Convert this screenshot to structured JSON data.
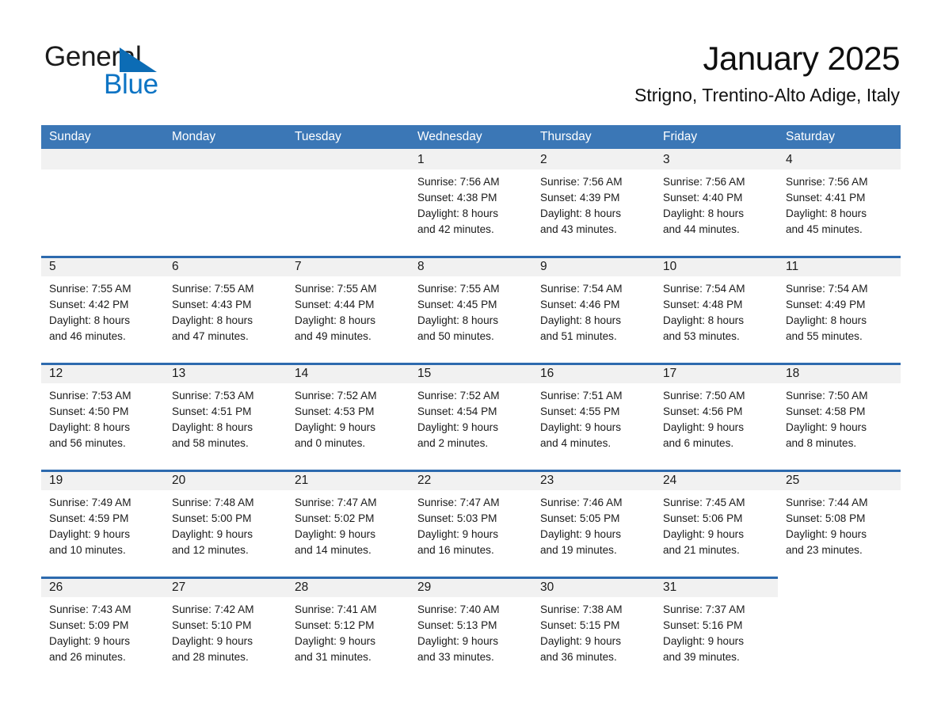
{
  "brand": {
    "line1": "General",
    "line2": "Blue",
    "triangle_color": "#0c6cb5",
    "text_color": "#0d74c4"
  },
  "header": {
    "month_title": "January 2025",
    "location": "Strigno, Trentino-Alto Adige, Italy"
  },
  "colors": {
    "header_blue": "#3b77b6",
    "row_divider_blue": "#2d6aae",
    "daynum_band": "#f1f1f1",
    "page_background": "#ffffff"
  },
  "weekdays": [
    "Sunday",
    "Monday",
    "Tuesday",
    "Wednesday",
    "Thursday",
    "Friday",
    "Saturday"
  ],
  "weeks": [
    [
      {
        "day": "",
        "sunrise": "",
        "sunset": "",
        "daylight1": "",
        "daylight2": ""
      },
      {
        "day": "",
        "sunrise": "",
        "sunset": "",
        "daylight1": "",
        "daylight2": ""
      },
      {
        "day": "",
        "sunrise": "",
        "sunset": "",
        "daylight1": "",
        "daylight2": ""
      },
      {
        "day": "1",
        "sunrise": "Sunrise: 7:56 AM",
        "sunset": "Sunset: 4:38 PM",
        "daylight1": "Daylight: 8 hours",
        "daylight2": "and 42 minutes."
      },
      {
        "day": "2",
        "sunrise": "Sunrise: 7:56 AM",
        "sunset": "Sunset: 4:39 PM",
        "daylight1": "Daylight: 8 hours",
        "daylight2": "and 43 minutes."
      },
      {
        "day": "3",
        "sunrise": "Sunrise: 7:56 AM",
        "sunset": "Sunset: 4:40 PM",
        "daylight1": "Daylight: 8 hours",
        "daylight2": "and 44 minutes."
      },
      {
        "day": "4",
        "sunrise": "Sunrise: 7:56 AM",
        "sunset": "Sunset: 4:41 PM",
        "daylight1": "Daylight: 8 hours",
        "daylight2": "and 45 minutes."
      }
    ],
    [
      {
        "day": "5",
        "sunrise": "Sunrise: 7:55 AM",
        "sunset": "Sunset: 4:42 PM",
        "daylight1": "Daylight: 8 hours",
        "daylight2": "and 46 minutes."
      },
      {
        "day": "6",
        "sunrise": "Sunrise: 7:55 AM",
        "sunset": "Sunset: 4:43 PM",
        "daylight1": "Daylight: 8 hours",
        "daylight2": "and 47 minutes."
      },
      {
        "day": "7",
        "sunrise": "Sunrise: 7:55 AM",
        "sunset": "Sunset: 4:44 PM",
        "daylight1": "Daylight: 8 hours",
        "daylight2": "and 49 minutes."
      },
      {
        "day": "8",
        "sunrise": "Sunrise: 7:55 AM",
        "sunset": "Sunset: 4:45 PM",
        "daylight1": "Daylight: 8 hours",
        "daylight2": "and 50 minutes."
      },
      {
        "day": "9",
        "sunrise": "Sunrise: 7:54 AM",
        "sunset": "Sunset: 4:46 PM",
        "daylight1": "Daylight: 8 hours",
        "daylight2": "and 51 minutes."
      },
      {
        "day": "10",
        "sunrise": "Sunrise: 7:54 AM",
        "sunset": "Sunset: 4:48 PM",
        "daylight1": "Daylight: 8 hours",
        "daylight2": "and 53 minutes."
      },
      {
        "day": "11",
        "sunrise": "Sunrise: 7:54 AM",
        "sunset": "Sunset: 4:49 PM",
        "daylight1": "Daylight: 8 hours",
        "daylight2": "and 55 minutes."
      }
    ],
    [
      {
        "day": "12",
        "sunrise": "Sunrise: 7:53 AM",
        "sunset": "Sunset: 4:50 PM",
        "daylight1": "Daylight: 8 hours",
        "daylight2": "and 56 minutes."
      },
      {
        "day": "13",
        "sunrise": "Sunrise: 7:53 AM",
        "sunset": "Sunset: 4:51 PM",
        "daylight1": "Daylight: 8 hours",
        "daylight2": "and 58 minutes."
      },
      {
        "day": "14",
        "sunrise": "Sunrise: 7:52 AM",
        "sunset": "Sunset: 4:53 PM",
        "daylight1": "Daylight: 9 hours",
        "daylight2": "and 0 minutes."
      },
      {
        "day": "15",
        "sunrise": "Sunrise: 7:52 AM",
        "sunset": "Sunset: 4:54 PM",
        "daylight1": "Daylight: 9 hours",
        "daylight2": "and 2 minutes."
      },
      {
        "day": "16",
        "sunrise": "Sunrise: 7:51 AM",
        "sunset": "Sunset: 4:55 PM",
        "daylight1": "Daylight: 9 hours",
        "daylight2": "and 4 minutes."
      },
      {
        "day": "17",
        "sunrise": "Sunrise: 7:50 AM",
        "sunset": "Sunset: 4:56 PM",
        "daylight1": "Daylight: 9 hours",
        "daylight2": "and 6 minutes."
      },
      {
        "day": "18",
        "sunrise": "Sunrise: 7:50 AM",
        "sunset": "Sunset: 4:58 PM",
        "daylight1": "Daylight: 9 hours",
        "daylight2": "and 8 minutes."
      }
    ],
    [
      {
        "day": "19",
        "sunrise": "Sunrise: 7:49 AM",
        "sunset": "Sunset: 4:59 PM",
        "daylight1": "Daylight: 9 hours",
        "daylight2": "and 10 minutes."
      },
      {
        "day": "20",
        "sunrise": "Sunrise: 7:48 AM",
        "sunset": "Sunset: 5:00 PM",
        "daylight1": "Daylight: 9 hours",
        "daylight2": "and 12 minutes."
      },
      {
        "day": "21",
        "sunrise": "Sunrise: 7:47 AM",
        "sunset": "Sunset: 5:02 PM",
        "daylight1": "Daylight: 9 hours",
        "daylight2": "and 14 minutes."
      },
      {
        "day": "22",
        "sunrise": "Sunrise: 7:47 AM",
        "sunset": "Sunset: 5:03 PM",
        "daylight1": "Daylight: 9 hours",
        "daylight2": "and 16 minutes."
      },
      {
        "day": "23",
        "sunrise": "Sunrise: 7:46 AM",
        "sunset": "Sunset: 5:05 PM",
        "daylight1": "Daylight: 9 hours",
        "daylight2": "and 19 minutes."
      },
      {
        "day": "24",
        "sunrise": "Sunrise: 7:45 AM",
        "sunset": "Sunset: 5:06 PM",
        "daylight1": "Daylight: 9 hours",
        "daylight2": "and 21 minutes."
      },
      {
        "day": "25",
        "sunrise": "Sunrise: 7:44 AM",
        "sunset": "Sunset: 5:08 PM",
        "daylight1": "Daylight: 9 hours",
        "daylight2": "and 23 minutes."
      }
    ],
    [
      {
        "day": "26",
        "sunrise": "Sunrise: 7:43 AM",
        "sunset": "Sunset: 5:09 PM",
        "daylight1": "Daylight: 9 hours",
        "daylight2": "and 26 minutes."
      },
      {
        "day": "27",
        "sunrise": "Sunrise: 7:42 AM",
        "sunset": "Sunset: 5:10 PM",
        "daylight1": "Daylight: 9 hours",
        "daylight2": "and 28 minutes."
      },
      {
        "day": "28",
        "sunrise": "Sunrise: 7:41 AM",
        "sunset": "Sunset: 5:12 PM",
        "daylight1": "Daylight: 9 hours",
        "daylight2": "and 31 minutes."
      },
      {
        "day": "29",
        "sunrise": "Sunrise: 7:40 AM",
        "sunset": "Sunset: 5:13 PM",
        "daylight1": "Daylight: 9 hours",
        "daylight2": "and 33 minutes."
      },
      {
        "day": "30",
        "sunrise": "Sunrise: 7:38 AM",
        "sunset": "Sunset: 5:15 PM",
        "daylight1": "Daylight: 9 hours",
        "daylight2": "and 36 minutes."
      },
      {
        "day": "31",
        "sunrise": "Sunrise: 7:37 AM",
        "sunset": "Sunset: 5:16 PM",
        "daylight1": "Daylight: 9 hours",
        "daylight2": "and 39 minutes."
      },
      {
        "day": "",
        "sunrise": "",
        "sunset": "",
        "daylight1": "",
        "daylight2": ""
      }
    ]
  ]
}
